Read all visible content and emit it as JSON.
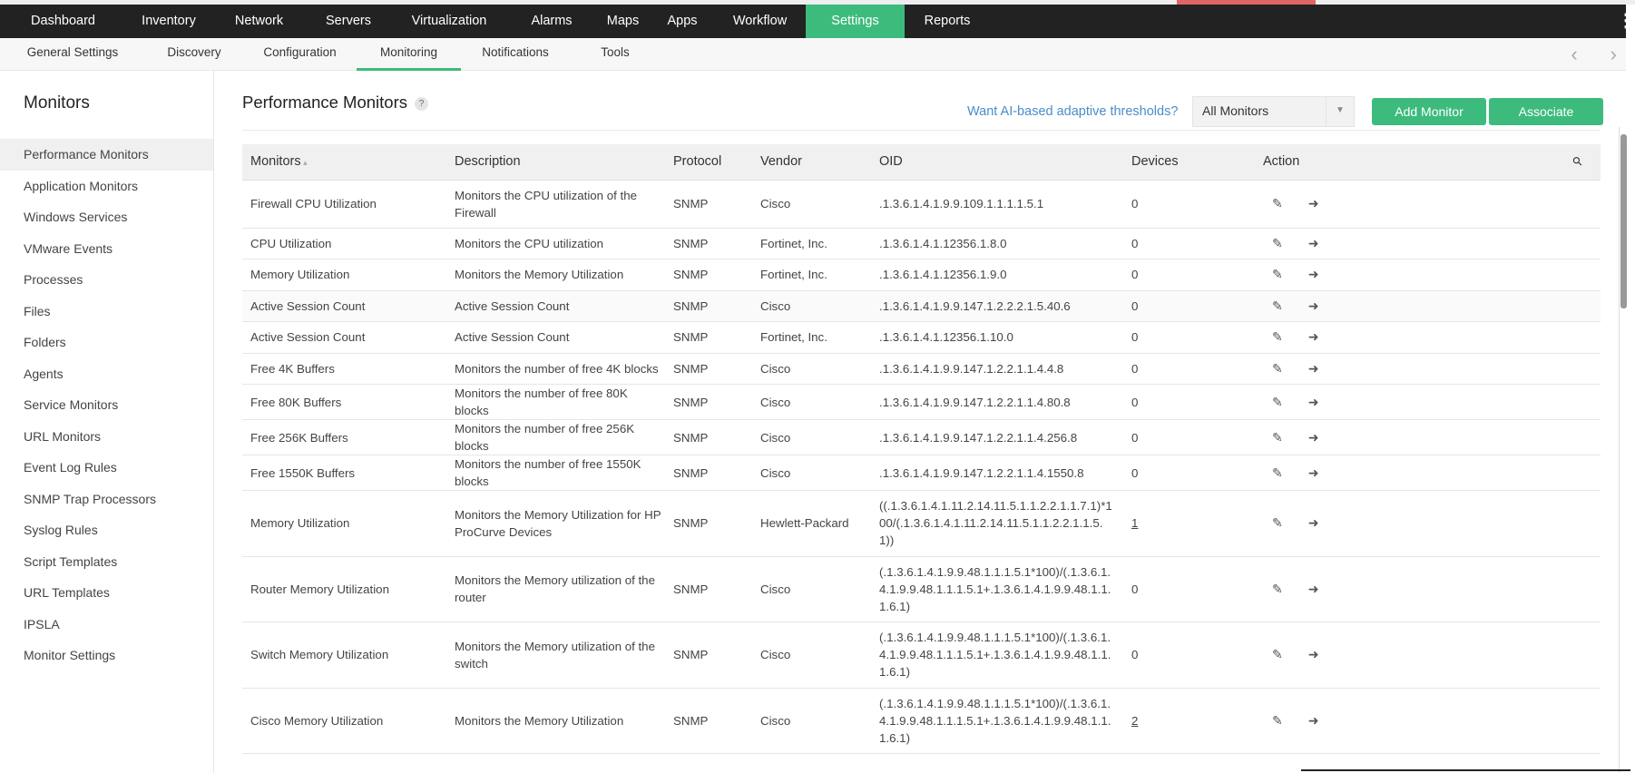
{
  "top_nav": [
    "Dashboard",
    "Inventory",
    "Network",
    "Servers",
    "Virtualization",
    "Alarms",
    "Maps",
    "Apps",
    "Workflow",
    "Settings",
    "Reports"
  ],
  "sub_nav": [
    "General Settings",
    "Discovery",
    "Configuration",
    "Monitoring",
    "Notifications",
    "Tools"
  ],
  "sidebar": {
    "title": "Monitors",
    "items": [
      "Performance Monitors",
      "Application Monitors",
      "Windows Services",
      "VMware Events",
      "Processes",
      "Files",
      "Folders",
      "Agents",
      "Service Monitors",
      "URL Monitors",
      "Event Log Rules",
      "SNMP Trap Processors",
      "Syslog Rules",
      "Script Templates",
      "URL Templates",
      "IPSLA",
      "Monitor Settings"
    ]
  },
  "page": {
    "title": "Performance Monitors",
    "help": "?",
    "ai_link": "Want AI-based adaptive thresholds?",
    "filter": "All Monitors",
    "add_button": "Add Monitor",
    "associate_button": "Associate"
  },
  "table": {
    "headers": [
      "Monitors",
      "Description",
      "Protocol",
      "Vendor",
      "OID",
      "Devices",
      "Action"
    ],
    "rows": [
      [
        "Firewall CPU Utilization",
        "Monitors the CPU utilization of the Firewall",
        "SNMP",
        "Cisco",
        ".1.3.6.1.4.1.9.9.109.1.1.1.1.5.1",
        "0"
      ],
      [
        "CPU Utilization",
        "Monitors the CPU utilization",
        "SNMP",
        "Fortinet, Inc.",
        ".1.3.6.1.4.1.12356.1.8.0",
        "0"
      ],
      [
        "Memory Utilization",
        "Monitors the Memory Utilization",
        "SNMP",
        "Fortinet, Inc.",
        ".1.3.6.1.4.1.12356.1.9.0",
        "0"
      ],
      [
        "Active Session Count",
        "Active Session Count",
        "SNMP",
        "Cisco",
        ".1.3.6.1.4.1.9.9.147.1.2.2.2.1.5.40.6",
        "0"
      ],
      [
        "Active Session Count",
        "Active Session Count",
        "SNMP",
        "Fortinet, Inc.",
        ".1.3.6.1.4.1.12356.1.10.0",
        "0"
      ],
      [
        "Free 4K Buffers",
        "Monitors the number of free 4K blocks",
        "SNMP",
        "Cisco",
        ".1.3.6.1.4.1.9.9.147.1.2.2.1.1.4.4.8",
        "0"
      ],
      [
        "Free 80K Buffers",
        "Monitors the number of free 80K blocks",
        "SNMP",
        "Cisco",
        ".1.3.6.1.4.1.9.9.147.1.2.2.1.1.4.80.8",
        "0"
      ],
      [
        "Free 256K Buffers",
        "Monitors the number of free 256K blocks",
        "SNMP",
        "Cisco",
        ".1.3.6.1.4.1.9.9.147.1.2.2.1.1.4.256.8",
        "0"
      ],
      [
        "Free 1550K Buffers",
        "Monitors the number of free 1550K blocks",
        "SNMP",
        "Cisco",
        ".1.3.6.1.4.1.9.9.147.1.2.2.1.1.4.1550.8",
        "0"
      ],
      [
        "Memory Utilization",
        "Monitors the Memory Utilization for HP ProCurve Devices",
        "SNMP",
        "Hewlett-Packard",
        "((.1.3.6.1.4.1.11.2.14.11.5.1.1.2.2.1.1.7.1)*100/(.1.3.6.1.4.1.11.2.14.11.5.1.1.2.2.1.1.5.1))",
        "1"
      ],
      [
        "Router Memory Utilization",
        "Monitors the Memory utilization of the router",
        "SNMP",
        "Cisco",
        "(.1.3.6.1.4.1.9.9.48.1.1.1.5.1*100)/(.1.3.6.1.4.1.9.9.48.1.1.1.5.1+.1.3.6.1.4.1.9.9.48.1.1.1.6.1)",
        "0"
      ],
      [
        "Switch Memory Utilization",
        "Monitors the Memory utilization of the switch",
        "SNMP",
        "Cisco",
        "(.1.3.6.1.4.1.9.9.48.1.1.1.5.1*100)/(.1.3.6.1.4.1.9.9.48.1.1.1.5.1+.1.3.6.1.4.1.9.9.48.1.1.1.6.1)",
        "0"
      ],
      [
        "Cisco Memory Utilization",
        "Monitors the Memory Utilization",
        "SNMP",
        "Cisco",
        "(.1.3.6.1.4.1.9.9.48.1.1.1.5.1*100)/(.1.3.6.1.4.1.9.9.48.1.1.1.5.1+.1.3.6.1.4.1.9.9.48.1.1.1.6.1)",
        "2"
      ]
    ]
  },
  "colors": {
    "accent": "#3dbb7d",
    "topbar": "#222222",
    "link": "#4a8cc9"
  }
}
